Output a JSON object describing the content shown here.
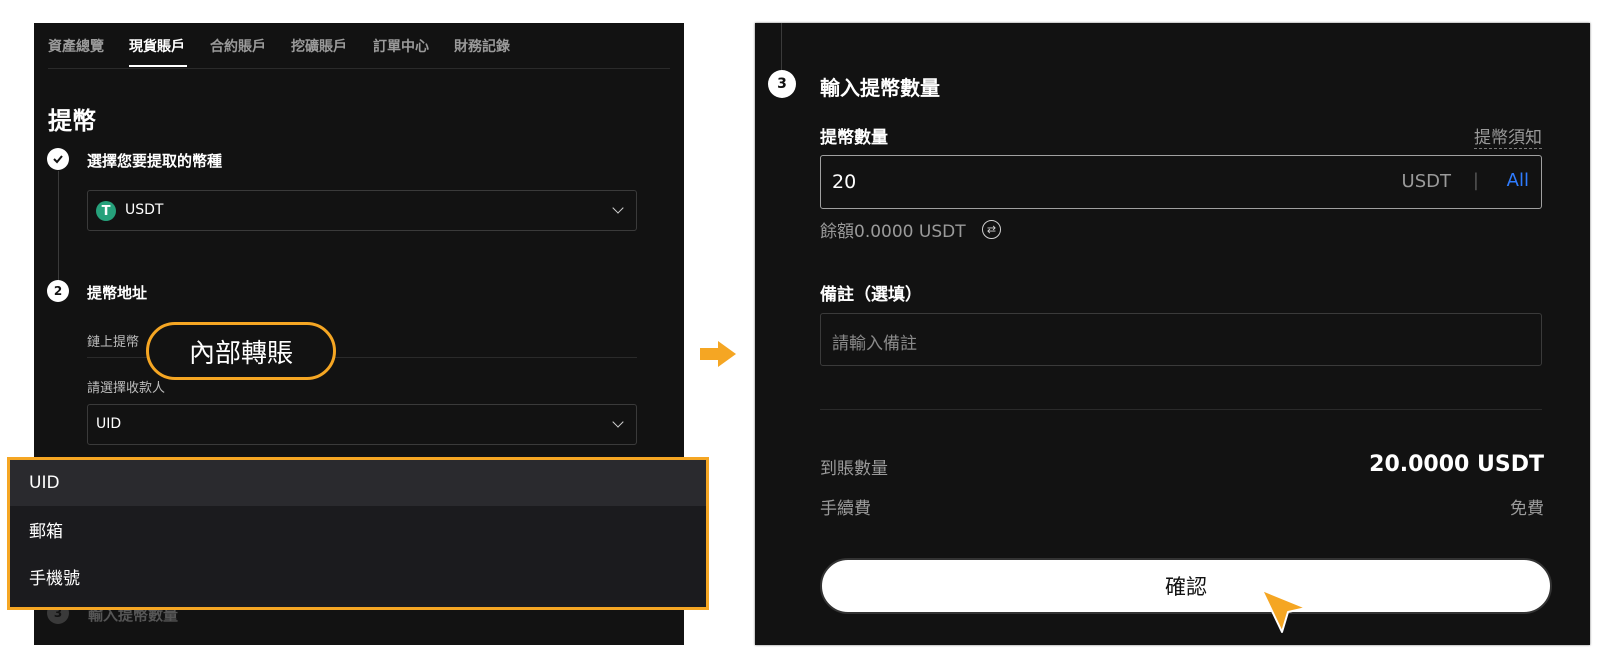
{
  "tabs": [
    "資產總覽",
    "現貨賬戶",
    "合約賬戶",
    "挖礦賬戶",
    "訂單中心",
    "財務記錄"
  ],
  "active_tab_index": 1,
  "page_title": "提幣",
  "step1": {
    "title": "選擇您要提取的幣種",
    "coin": "USDT",
    "coin_icon": "T"
  },
  "step2": {
    "number": "2",
    "title": "提幣地址",
    "method_label": "鏈上提幣",
    "callout": "內部轉賬",
    "recipient_label": "請選擇收款人",
    "recipient_value": "UID",
    "dropdown_options": [
      "UID",
      "郵箱",
      "手機號"
    ]
  },
  "step3": {
    "number": "3",
    "title": "輸入提幣數量",
    "faded_title": "輸入提幣數量",
    "amount_label": "提幣數量",
    "notice_link": "提幣須知",
    "amount_value": "20",
    "unit": "USDT",
    "separator": "|",
    "all_label": "All",
    "balance": "餘額0.0000 USDT",
    "remark_label": "備註（選填）",
    "remark_placeholder": "請輸入備註",
    "received_label": "到賬數量",
    "received_value": "20.0000 USDT",
    "fee_label": "手續費",
    "fee_value": "免費",
    "confirm_label": "確認"
  },
  "colors": {
    "accent": "#f5a623",
    "background": "#121212",
    "link_blue": "#2f7cff",
    "tether_green": "#26a17b"
  }
}
